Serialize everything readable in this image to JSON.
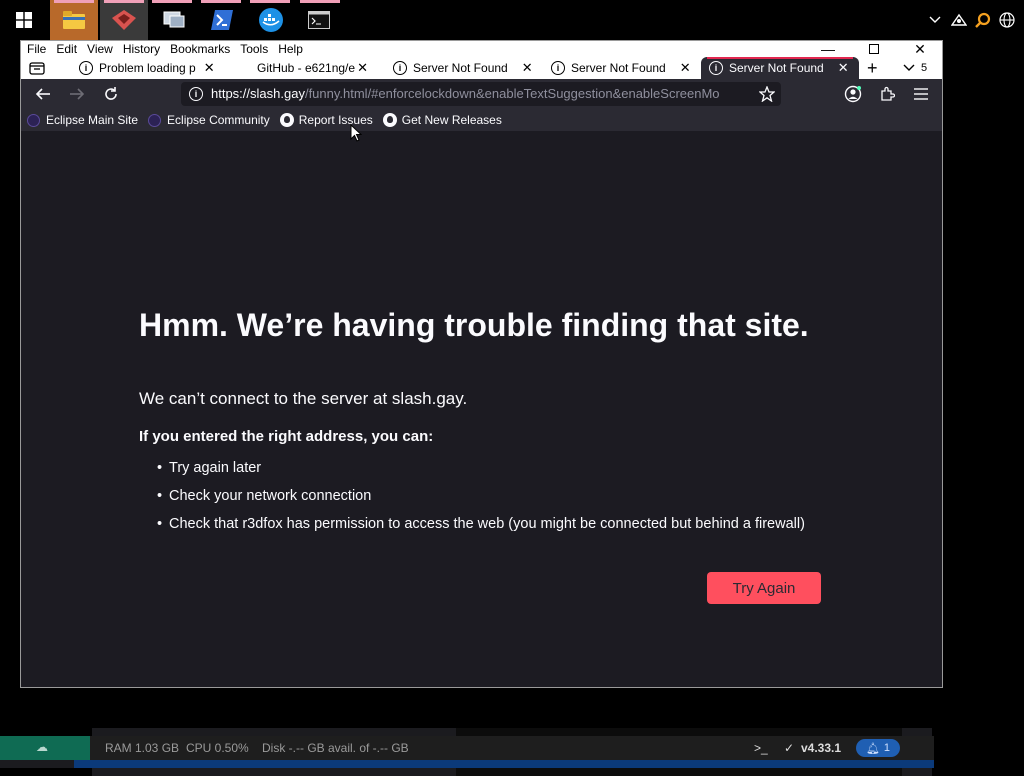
{
  "taskbar": {
    "apps": [
      {
        "name": "File Explorer",
        "icon": "folder-icon"
      },
      {
        "name": "App",
        "icon": "app-icon"
      },
      {
        "name": "Remote",
        "icon": "remote-icon"
      },
      {
        "name": "PowerShell",
        "icon": "powershell-icon"
      },
      {
        "name": "Docker",
        "icon": "docker-icon"
      },
      {
        "name": "Terminal",
        "icon": "terminal-icon"
      }
    ]
  },
  "browser": {
    "menu": [
      "File",
      "Edit",
      "View",
      "History",
      "Bookmarks",
      "Tools",
      "Help"
    ],
    "tabs": [
      {
        "label": "Problem loading p",
        "closable": true
      },
      {
        "label": "GitHub - e621ng/e",
        "closable": true
      },
      {
        "label": "Server Not Found",
        "closable": true
      },
      {
        "label": "Server Not Found",
        "closable": true
      },
      {
        "label": "Server Not Found",
        "closable": true,
        "active": true
      }
    ],
    "tab_count": "5",
    "url_host": "https://slash.gay",
    "url_rest": "/funny.html/#enforcelockdown&enableTextSuggestion&enableScreenMo",
    "bookmarks": [
      {
        "label": "Eclipse Main Site",
        "icon": "eclipse-icon"
      },
      {
        "label": "Eclipse Community",
        "icon": "eclipse-icon"
      },
      {
        "label": "Report Issues",
        "icon": "github-icon"
      },
      {
        "label": "Get New Releases",
        "icon": "github-icon"
      }
    ]
  },
  "error_page": {
    "title": "Hmm. We’re having trouble finding that site.",
    "description": "We can’t connect to the server at slash.gay.",
    "lead": "If you entered the right address, you can:",
    "items": [
      "Try again later",
      "Check your network connection",
      "Check that r3dfox has permission to access the web (you might be connected but behind a firewall)"
    ],
    "button_label": "Try Again"
  },
  "background_app": {
    "status": {
      "ram": "RAM 1.03 GB",
      "cpu": "CPU 0.50%",
      "disk": "Disk -.-- GB avail. of -.-- GB",
      "version": "v4.33.1",
      "notifications": "1"
    }
  },
  "colors": {
    "accent": "#ff4f5e",
    "page_bg": "#1c1b22",
    "toolbar_bg": "#2b2a33",
    "tab_active_line": "#e22850"
  }
}
